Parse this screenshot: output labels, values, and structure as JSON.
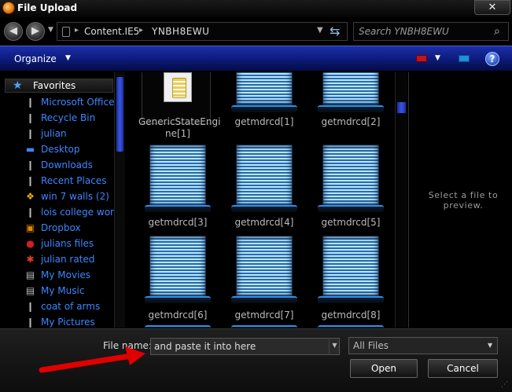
{
  "window": {
    "title": "File Upload",
    "close_glyph": "✕",
    "app_icon": "firefox-icon"
  },
  "address": {
    "crumbs": [
      "Content.IE5",
      "YNBH8EWU"
    ],
    "separator": "▸",
    "back_glyph": "◀",
    "forward_glyph": "▶",
    "dropdown_glyph": "▼",
    "refresh_glyph": "⇆"
  },
  "search": {
    "placeholder": "Search YNBH8EWU",
    "icon_glyph": "⌕"
  },
  "toolbar": {
    "organize_label": "Organize",
    "arrow": "▼",
    "help_glyph": "?"
  },
  "nav": {
    "favorites_label": "Favorites",
    "favorites_icon": "★",
    "items": [
      {
        "label": "Microsoft Office",
        "icon": "❙"
      },
      {
        "label": "Recycle Bin",
        "icon": "❙"
      },
      {
        "label": "julian",
        "icon": "❙"
      },
      {
        "label": "Desktop",
        "icon": "▬"
      },
      {
        "label": "Downloads",
        "icon": "❙"
      },
      {
        "label": "Recent Places",
        "icon": "❙"
      },
      {
        "label": "win 7 walls (2)",
        "icon": "❖"
      },
      {
        "label": "lois college work",
        "icon": "❙"
      },
      {
        "label": "Dropbox",
        "icon": "▣"
      },
      {
        "label": "julians files",
        "icon": "●"
      },
      {
        "label": "julian rated",
        "icon": "✱"
      },
      {
        "label": "My Movies",
        "icon": "▤"
      },
      {
        "label": "My Music",
        "icon": "▤"
      },
      {
        "label": "coat of arms",
        "icon": "❙"
      },
      {
        "label": "My Pictures",
        "icon": "❙"
      }
    ]
  },
  "files": [
    {
      "line1": "GenericStateEngi",
      "line2": "ne[1]"
    },
    {
      "line1": "getmdrcd[1]",
      "line2": ""
    },
    {
      "line1": "getmdrcd[2]",
      "line2": ""
    },
    {
      "line1": "getmdrcd[3]",
      "line2": ""
    },
    {
      "line1": "getmdrcd[4]",
      "line2": ""
    },
    {
      "line1": "getmdrcd[5]",
      "line2": ""
    },
    {
      "line1": "getmdrcd[6]",
      "line2": ""
    },
    {
      "line1": "getmdrcd[7]",
      "line2": ""
    },
    {
      "line1": "getmdrcd[8]",
      "line2": ""
    }
  ],
  "preview": {
    "text": "Select a file to preview."
  },
  "bottom": {
    "filename_label": "File name:",
    "filename_value": "and paste it into here",
    "filter_value": "All Files",
    "open_label": "Open",
    "cancel_label": "Cancel",
    "grip_glyph": "⋰"
  },
  "colors": {
    "accent": "#3d86ff",
    "toolbar": "#0c1a7a",
    "annotation_arrow": "#e00000"
  }
}
